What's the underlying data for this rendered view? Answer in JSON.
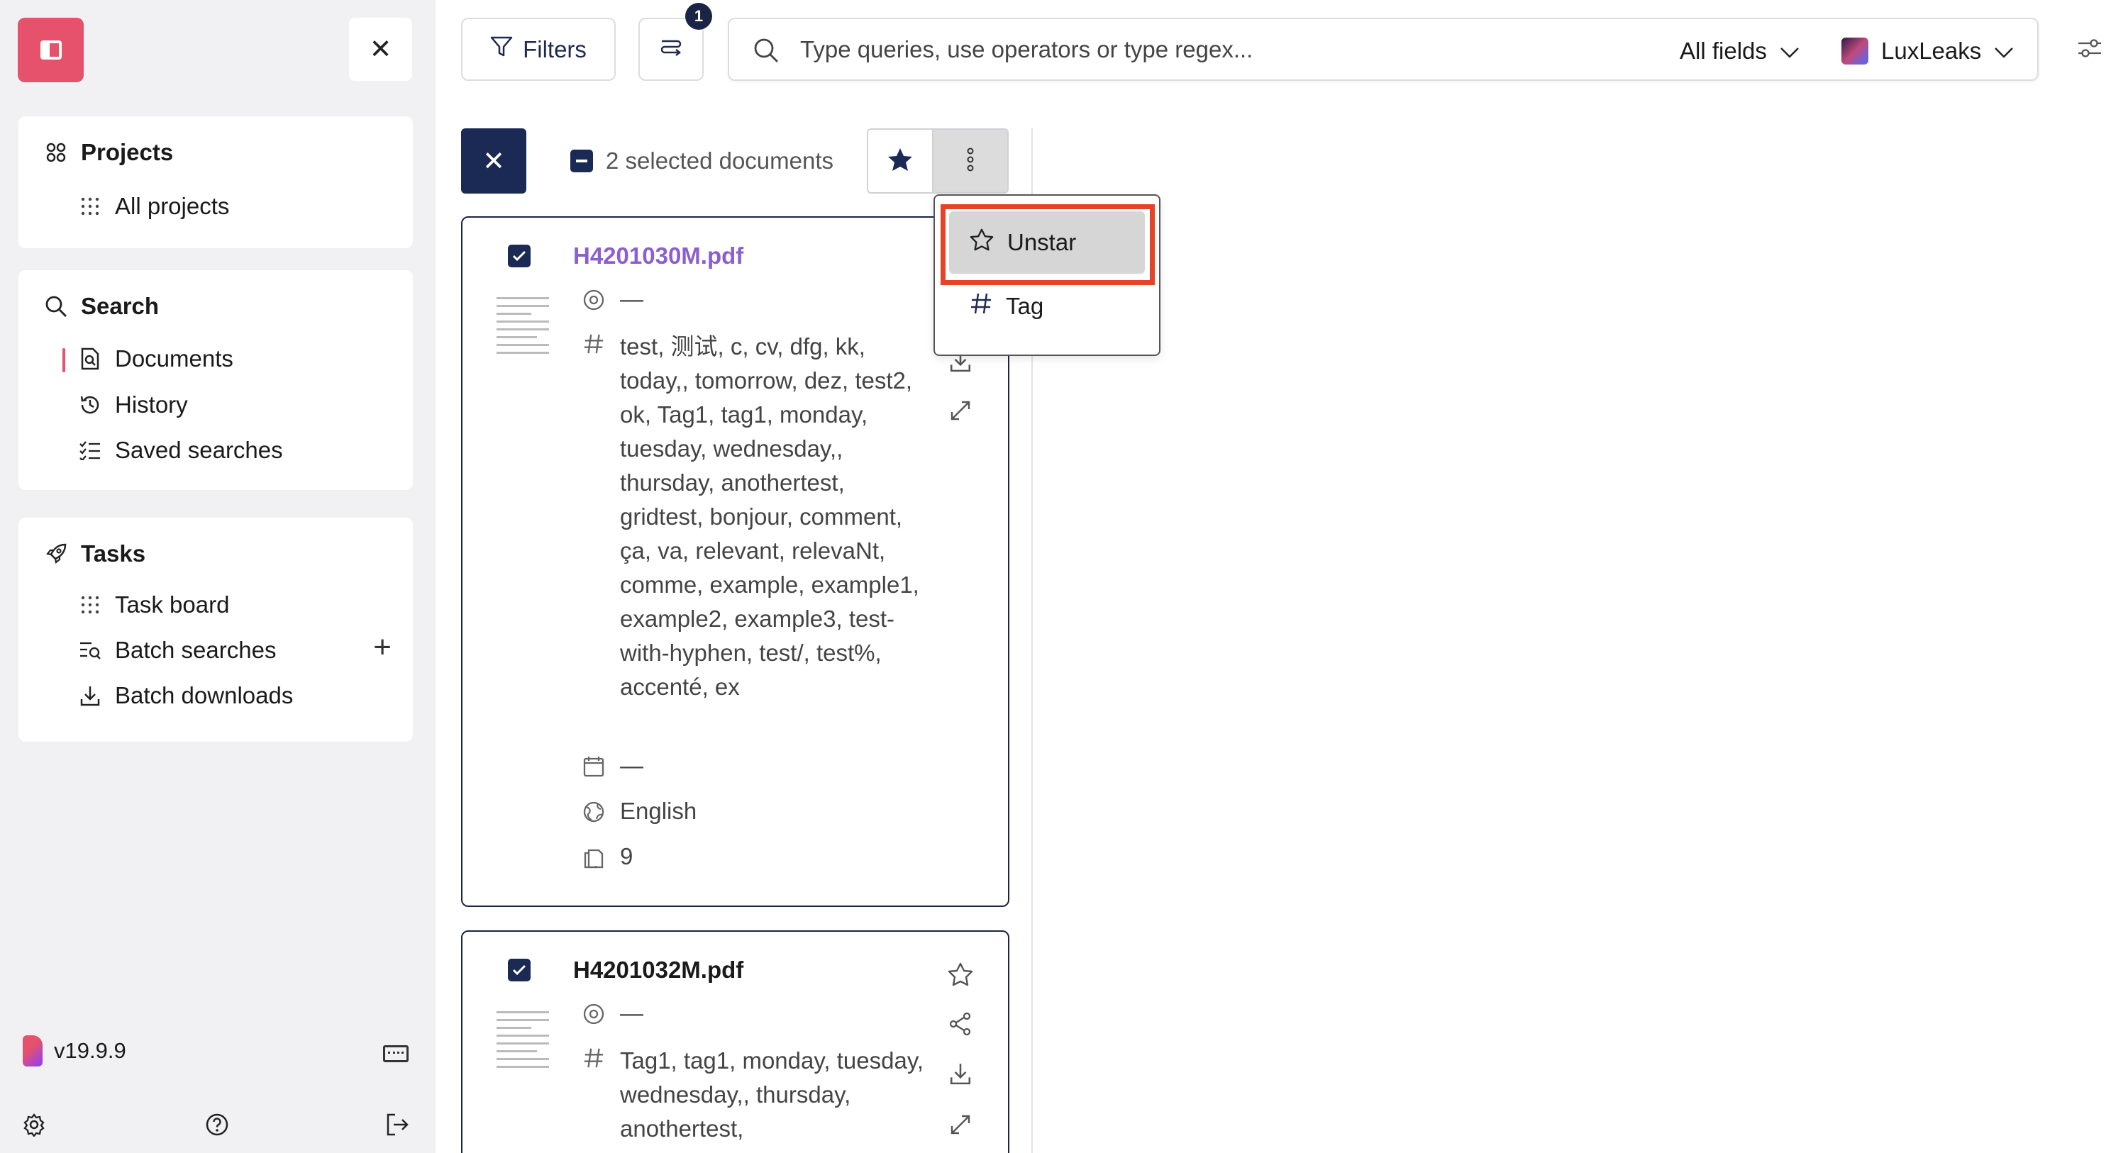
{
  "sidebar": {
    "projects": {
      "heading": "Projects",
      "items": [
        {
          "label": "All projects"
        }
      ]
    },
    "search": {
      "heading": "Search",
      "items": [
        {
          "label": "Documents"
        },
        {
          "label": "History"
        },
        {
          "label": "Saved searches"
        }
      ]
    },
    "tasks": {
      "heading": "Tasks",
      "items": [
        {
          "label": "Task board"
        },
        {
          "label": "Batch searches"
        },
        {
          "label": "Batch downloads"
        }
      ]
    },
    "version": "v19.9.9"
  },
  "toolbar": {
    "filters_label": "Filters",
    "sort_badge": "1",
    "search_placeholder": "Type queries, use operators or type regex...",
    "fields_label": "All fields",
    "project_label": "LuxLeaks"
  },
  "selection": {
    "count_label": "2 selected documents"
  },
  "menu": {
    "items": [
      {
        "label": "Unstar"
      },
      {
        "label": "Tag"
      }
    ]
  },
  "documents": [
    {
      "title": "H4201030M.pdf",
      "author": "—",
      "tags": "test, 测试, c, cv, dfg, kk, today,, tomorrow, dez, test2, ok, Tag1, tag1, monday, tuesday, wednesday,, thursday, anothertest, gridtest, bonjour, comment, ça, va, relevant, relevaNt, comme, example, example1, example2, example3, test-with-hyphen, test/, test%, accenté, ex",
      "date": "—",
      "language": "English",
      "pages": "9"
    },
    {
      "title": "H4201032M.pdf",
      "author": "—",
      "tags": "Tag1, tag1, monday, tuesday, wednesday,, thursday, anothertest,"
    }
  ],
  "colors": {
    "brand": "#e6526b",
    "navy": "#1a2a55",
    "link": "#8b5fd0",
    "highlight": "#e5432a"
  }
}
